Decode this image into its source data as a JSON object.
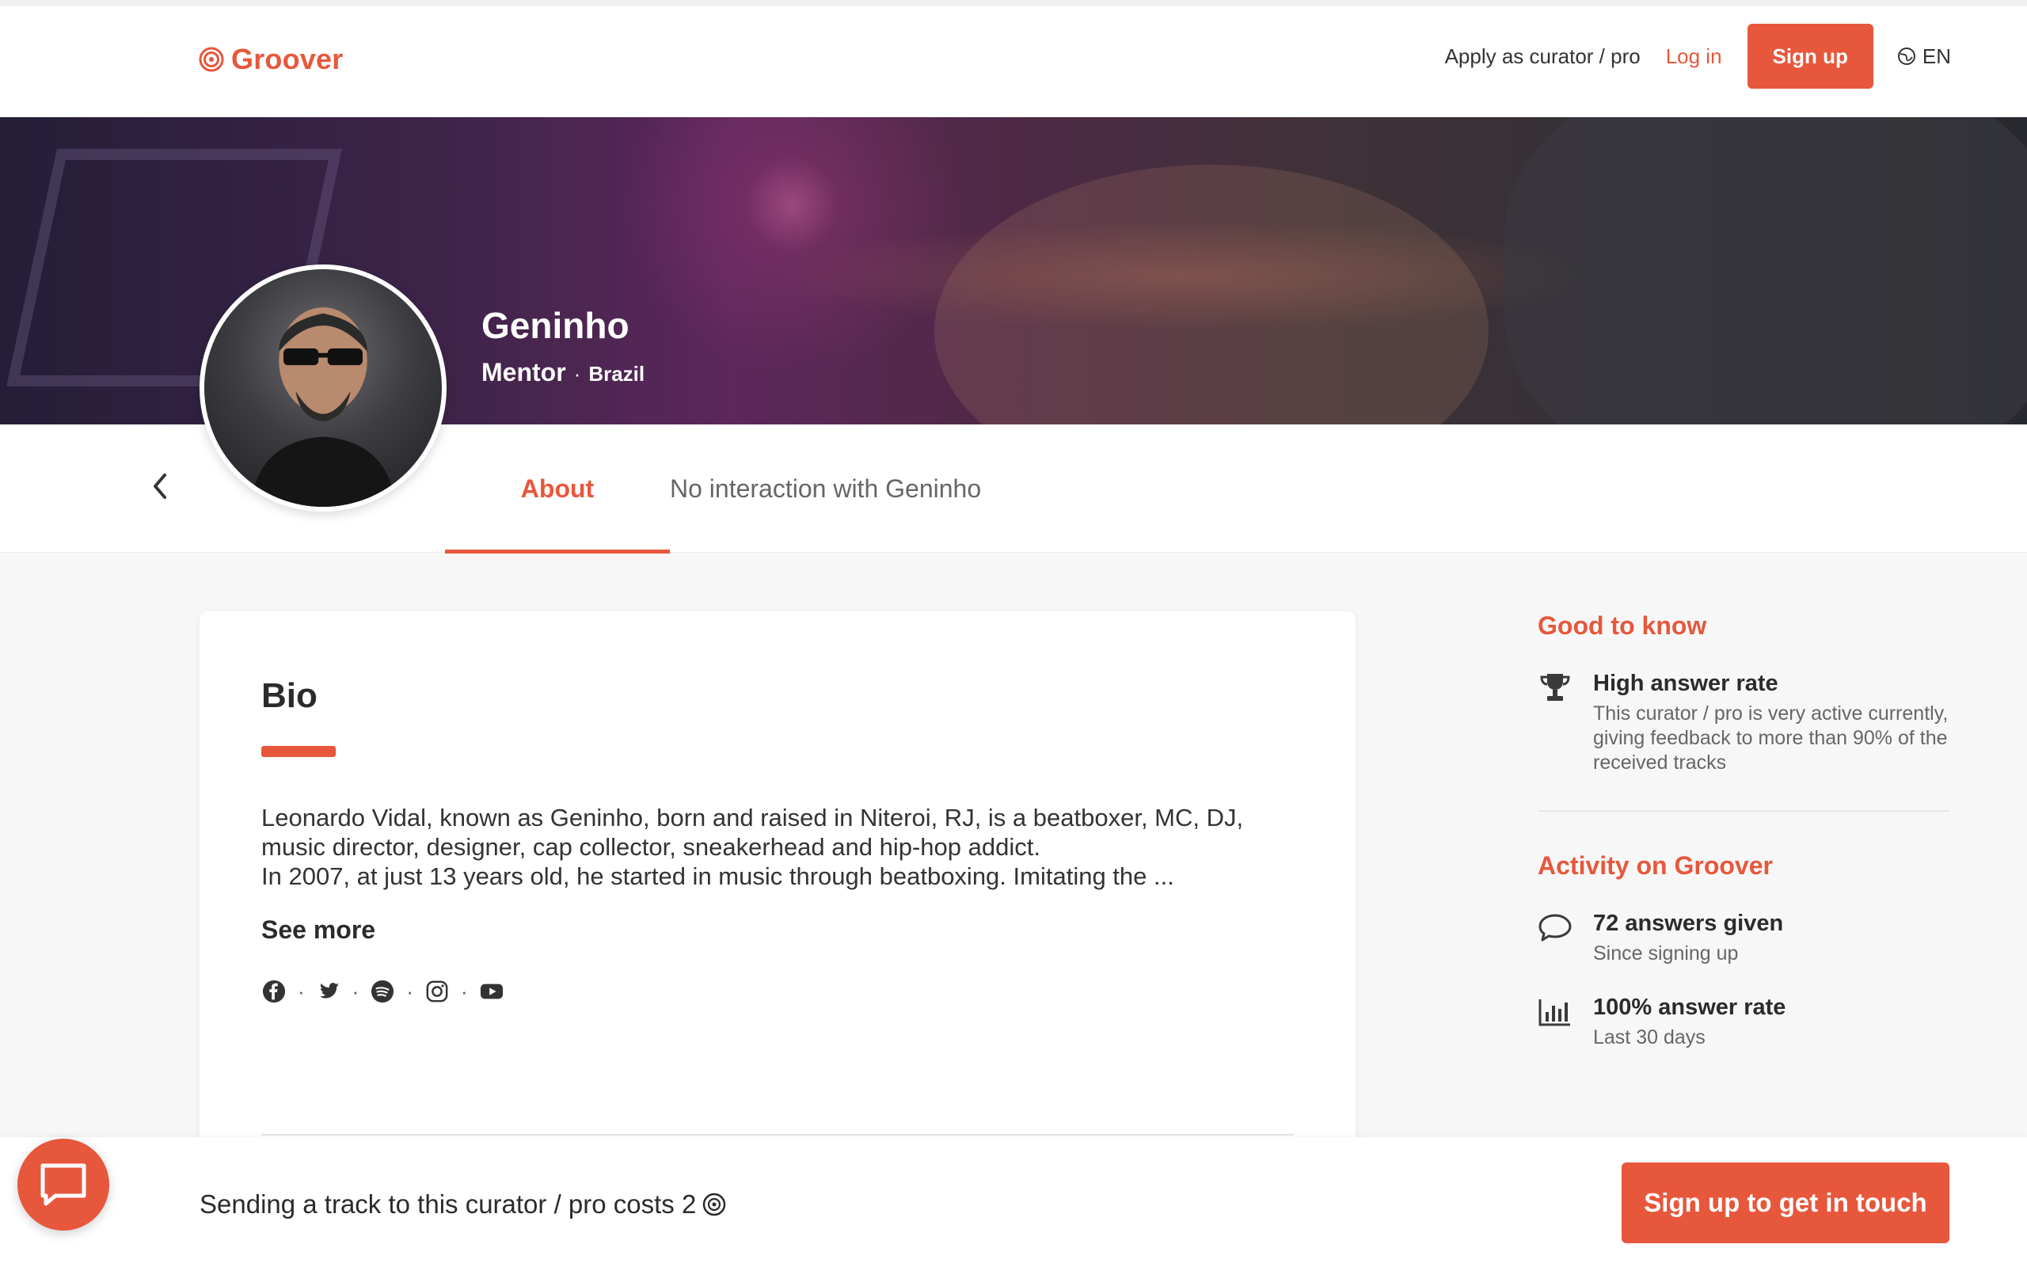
{
  "brand": {
    "name": "Groover",
    "accent": "#e7573c"
  },
  "nav": {
    "apply_label": "Apply as curator / pro",
    "login_label": "Log in",
    "signup_label": "Sign up",
    "language": "EN"
  },
  "profile": {
    "name": "Geninho",
    "role": "Mentor",
    "separator": "·",
    "country": "Brazil"
  },
  "tabs": [
    {
      "label": "About",
      "active": true
    },
    {
      "label": "No interaction with Geninho",
      "active": false
    }
  ],
  "bio": {
    "title": "Bio",
    "lines": [
      "Leonardo Vidal, known as Geninho, born and raised in Niteroi, RJ, is a beatboxer, MC, DJ, music director, designer, cap collector, sneakerhead and hip-hop addict.",
      "In 2007, at just 13 years old, he started in music through beatboxing. Imitating the ..."
    ],
    "see_more": "See more",
    "socials": [
      "facebook-icon",
      "twitter-icon",
      "spotify-icon",
      "instagram-icon",
      "youtube-icon"
    ],
    "separator": "·"
  },
  "sidebar": {
    "good_to_know": {
      "heading": "Good to know",
      "items": [
        {
          "icon": "trophy-icon",
          "title": "High answer rate",
          "description": "This curator / pro is very active currently, giving feedback to more than 90% of the received tracks"
        }
      ]
    },
    "activity": {
      "heading": "Activity on Groover",
      "items": [
        {
          "icon": "speech-bubble-icon",
          "title": "72 answers given",
          "description": "Since signing up"
        },
        {
          "icon": "bar-chart-icon",
          "title": "100% answer rate",
          "description": "Last 30 days"
        }
      ]
    }
  },
  "footer": {
    "cost_text": "Sending a track to this curator / pro costs 2",
    "cta_label": "Sign up to get in touch"
  }
}
